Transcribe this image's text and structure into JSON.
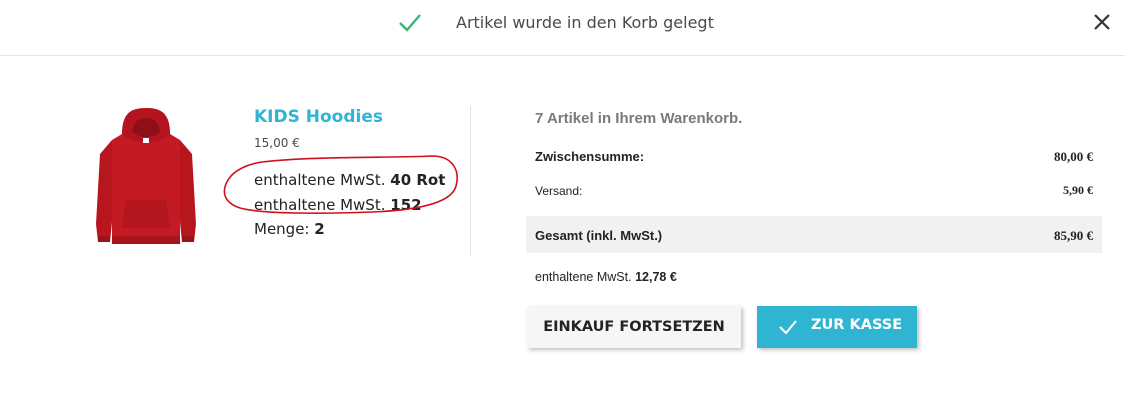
{
  "header": {
    "message": "Artikel wurde in den Korb gelegt",
    "check_icon": "check-icon",
    "close_icon": "close-icon",
    "check_color": "#3cb371"
  },
  "product": {
    "name": "KIDS Hoodies",
    "price": "15,00 €",
    "tax_label": "enthaltene MwSt.",
    "tax_value_1": "40 Rot",
    "tax_value_2": "152",
    "quantity_label": "Menge:",
    "quantity": "2",
    "image": "red-hoodie-image",
    "name_color": "#2fb5d2",
    "annotation_color": "#d0101e"
  },
  "cart": {
    "count_text": "7 Artikel in Ihrem Warenkorb.",
    "subtotal_label": "Zwischensumme:",
    "subtotal_value": "80,00 €",
    "shipping_label": "Versand:",
    "shipping_value": "5,90 €",
    "total_label": "Gesamt (inkl. MwSt.)",
    "total_value": "85,90 €",
    "tax_label": "enthaltene MwSt.",
    "tax_value": "12,78 €"
  },
  "actions": {
    "continue_label": "EINKAUF FORTSETZEN",
    "checkout_label": "ZUR KASSE",
    "checkout_color": "#2fb5d2"
  }
}
